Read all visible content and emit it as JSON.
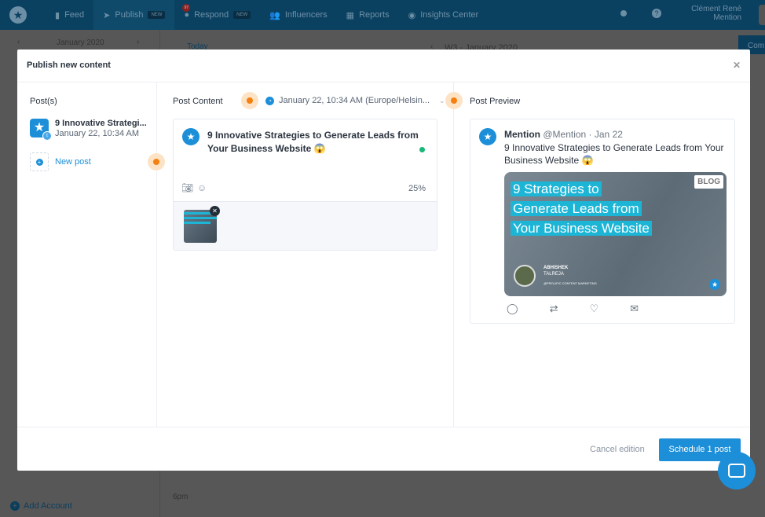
{
  "nav": {
    "items": [
      {
        "label": "Feed",
        "icon": "feed-icon"
      },
      {
        "label": "Publish",
        "icon": "send-icon",
        "badge": "NEW"
      },
      {
        "label": "Respond",
        "icon": "chat-icon",
        "badge": "NEW",
        "count": "97"
      },
      {
        "label": "Influencers",
        "icon": "users-icon"
      },
      {
        "label": "Reports",
        "icon": "reports-icon"
      },
      {
        "label": "Insights Center",
        "icon": "compass-icon"
      }
    ],
    "user_name": "Clément René",
    "user_org": "Mention"
  },
  "calendar": {
    "month": "January 2020",
    "today": "Today",
    "week": "W3 - January 2020",
    "time_6pm": "6pm",
    "add_account": "Add Account",
    "create": "Com"
  },
  "modal": {
    "title": "Publish new content",
    "posts_label": "Post(s)",
    "post": {
      "title": "9 Innovative Strategi...",
      "date": "January 22, 10:34 AM"
    },
    "new_post": "New post",
    "content_label": "Post Content",
    "schedule": "January 22, 10:34 AM (Europe/Helsin...",
    "text": "9 Innovative Strategies to Generate Leads from Your Business Website 😱",
    "progress": "25%",
    "preview_label": "Post Preview",
    "preview": {
      "name": "Mention",
      "handle": "@Mention · Jan 22",
      "text": "9 Innovative Strategies to Generate Leads from Your Business Website 😱",
      "image_lines": [
        "9 Strategies to",
        "Generate Leads from",
        "Your Business Website"
      ],
      "blog": "BLOG",
      "author": "ABHISHEK",
      "author2": "TALREJA",
      "author_tag": "@PROLIFIC CONTENT MARKETING"
    },
    "cancel": "Cancel edition",
    "submit": "Schedule 1 post"
  },
  "colors": {
    "accent": "#1c8fd8",
    "nav": "#0b4160",
    "highlight": "#f57f0f"
  }
}
